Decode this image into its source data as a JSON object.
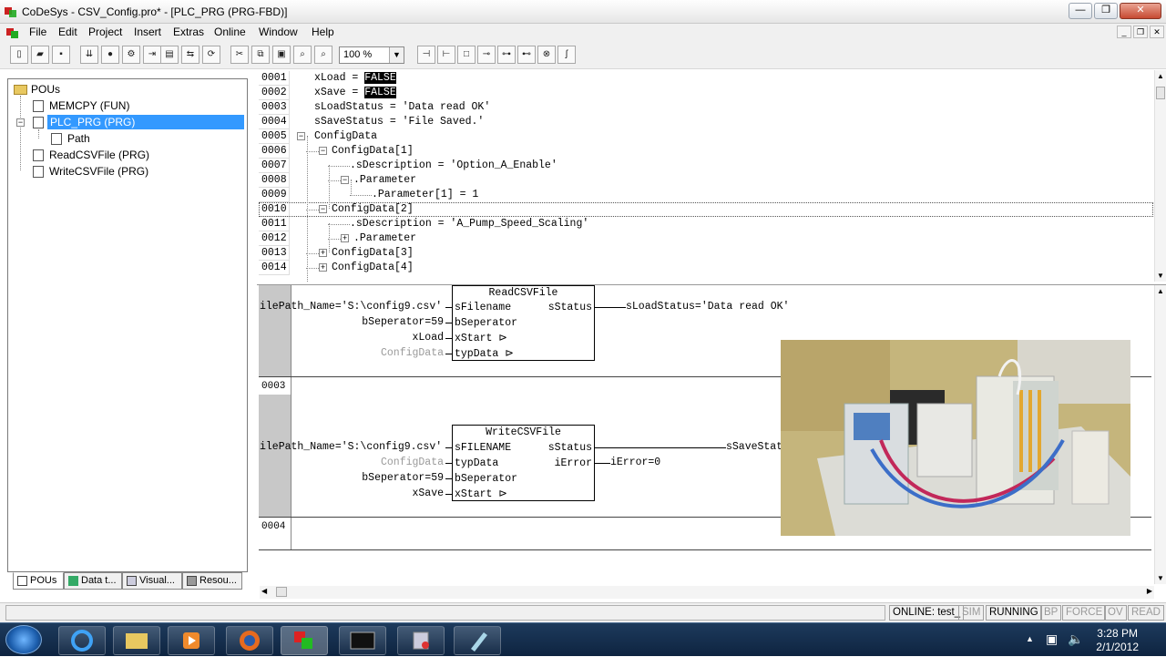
{
  "window": {
    "title": "CoDeSys - CSV_Config.pro* - [PLC_PRG (PRG-FBD)]"
  },
  "menu": [
    "File",
    "Edit",
    "Project",
    "Insert",
    "Extras",
    "Online",
    "Window",
    "Help"
  ],
  "toolbar": {
    "zoom": "100 %"
  },
  "tree": {
    "root": "POUs",
    "items": [
      "MEMCPY (FUN)",
      "PLC_PRG (PRG)",
      "Path",
      "ReadCSVFile (PRG)",
      "WriteCSVFile (PRG)"
    ],
    "selected": "PLC_PRG (PRG)"
  },
  "tabs": [
    "POUs",
    "Data t...",
    "Visual...",
    "Resou..."
  ],
  "editor": {
    "lines": [
      {
        "num": "0001",
        "indent": 0,
        "text": "xLoad = ",
        "value": "FALSE"
      },
      {
        "num": "0002",
        "indent": 0,
        "text": "xSave = ",
        "value": "FALSE"
      },
      {
        "num": "0003",
        "indent": 0,
        "text": "sLoadStatus = 'Data read OK'"
      },
      {
        "num": "0004",
        "indent": 0,
        "text": "sSaveStatus = 'File Saved.'"
      },
      {
        "num": "0005",
        "indent": 0,
        "text": "ConfigData",
        "expander": "minus"
      },
      {
        "num": "0006",
        "indent": 1,
        "text": "ConfigData[1]",
        "expander": "minus"
      },
      {
        "num": "0007",
        "indent": 2,
        "text": ".sDescription = 'Option_A_Enable'"
      },
      {
        "num": "0008",
        "indent": 2,
        "text": ".Parameter",
        "expander": "minus"
      },
      {
        "num": "0009",
        "indent": 3,
        "text": ".Parameter[1] = 1"
      },
      {
        "num": "0010",
        "indent": 1,
        "text": "ConfigData[2]",
        "expander": "minus",
        "focused": true
      },
      {
        "num": "0011",
        "indent": 2,
        "text": ".sDescription = 'A_Pump_Speed_Scaling'"
      },
      {
        "num": "0012",
        "indent": 2,
        "text": ".Parameter",
        "expander": "plus"
      },
      {
        "num": "0013",
        "indent": 1,
        "text": "ConfigData[3]",
        "expander": "plus"
      },
      {
        "num": "0014",
        "indent": 1,
        "text": "ConfigData[4]",
        "expander": "plus"
      }
    ]
  },
  "fbd": {
    "read": {
      "name": "ReadCSVFile",
      "inputs": [
        "sFilename",
        "bSeperator",
        "xStart ⊳",
        "typData ⊳"
      ],
      "in_values": [
        "ilePath_Name='S:\\config9.csv'",
        "bSeperator=59",
        "xLoad",
        "ConfigData"
      ],
      "output": "sStatus",
      "out_value": "sLoadStatus='Data read OK'"
    },
    "write": {
      "network": "0003",
      "name": "WriteCSVFile",
      "inputs": [
        "sFILENAME",
        "typData",
        "bSeperator",
        "xStart ⊳"
      ],
      "in_values": [
        "ilePath_Name='S:\\config9.csv'",
        "ConfigData",
        "bSeperator=59",
        "xSave"
      ],
      "outputs": [
        "sStatus",
        "iError"
      ],
      "out_values": [
        "sSaveStat",
        "iError=0"
      ]
    },
    "network4": "0004"
  },
  "status": [
    "ONLINE: test_",
    "SIM",
    "RUNNING",
    "BP",
    "FORCE",
    "OV",
    "READ"
  ],
  "clock": {
    "time": "3:28 PM",
    "date": "2/1/2012"
  }
}
